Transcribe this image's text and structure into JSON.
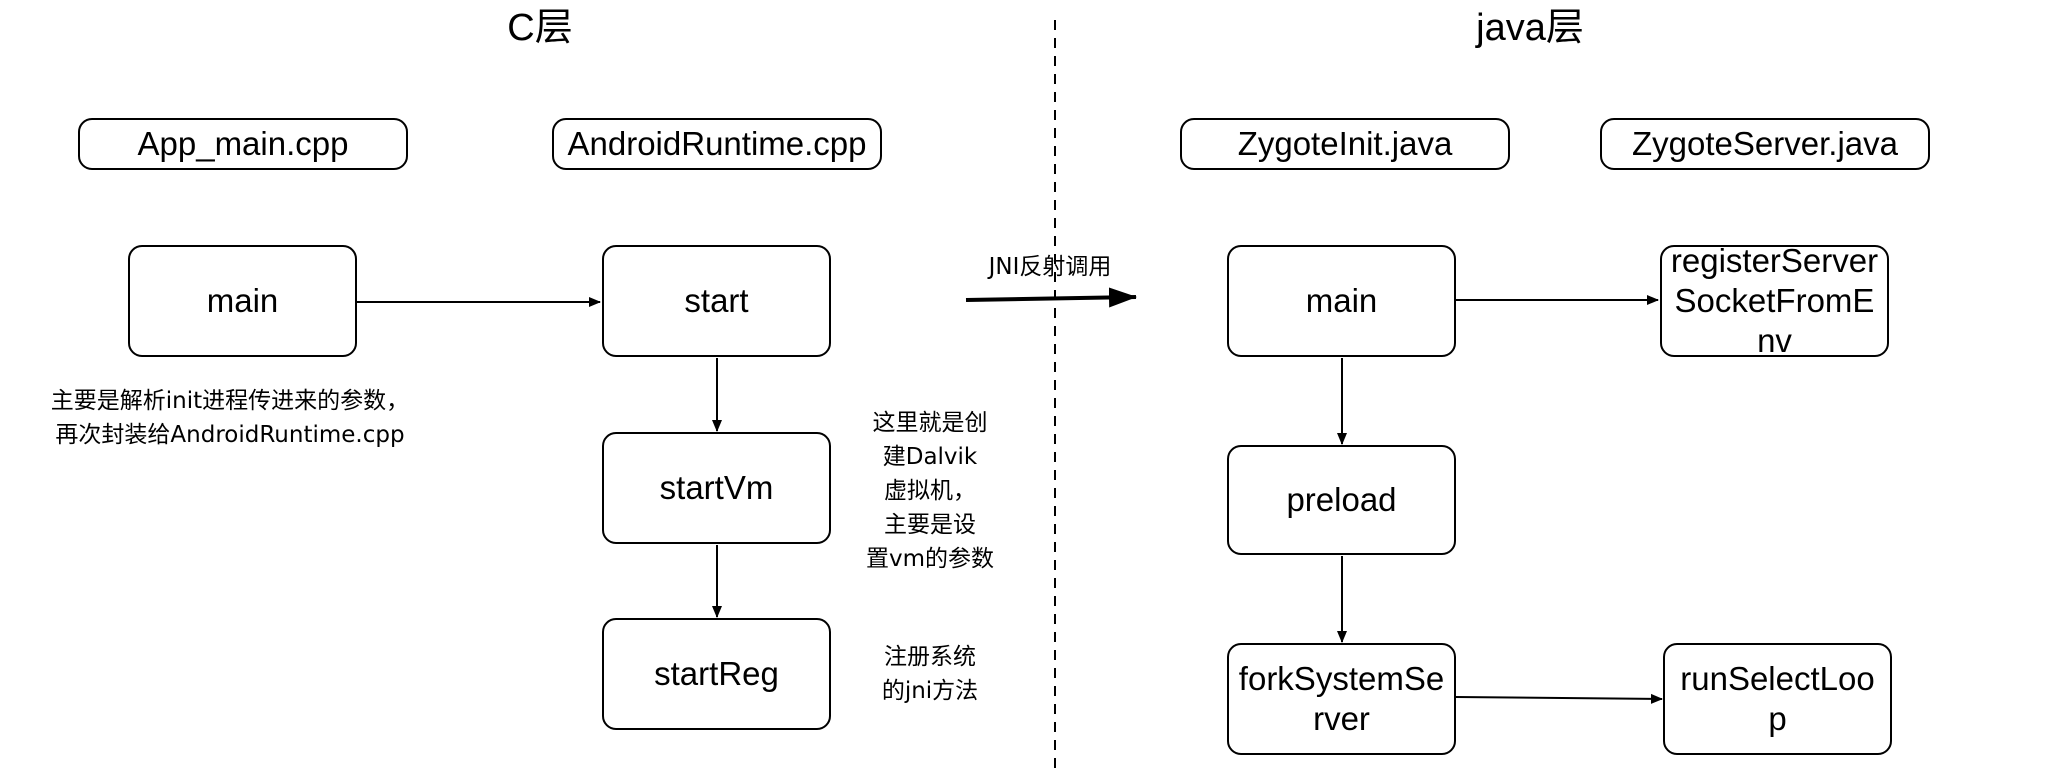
{
  "titles": {
    "c_layer": "C层",
    "java_layer": "java层"
  },
  "files": {
    "app_main": "App_main.cpp",
    "android_runtime": "AndroidRuntime.cpp",
    "zygote_init": "ZygoteInit.java",
    "zygote_server": "ZygoteServer.java"
  },
  "nodes": {
    "c_main": "main",
    "start": "start",
    "start_vm": "startVm",
    "start_reg": "startReg",
    "java_main": "main",
    "register_server": "registerServerSocketFromEnv",
    "preload": "preload",
    "fork_system_server": "forkSystemServer",
    "run_select_loop": "runSelectLoop"
  },
  "notes": {
    "main_note_line1": "主要是解析init进程传进来的参数，",
    "main_note_line2": "再次封装给AndroidRuntime.cpp",
    "startvm_note_line1": "这里就是创",
    "startvm_note_line2": "建Dalvik",
    "startvm_note_line3": "虚拟机，",
    "startvm_note_line4": "主要是设",
    "startvm_note_line5": "置vm的参数",
    "startreg_note_line1": "注册系统",
    "startreg_note_line2": "的jni方法",
    "jni_label": "JNI反射调用"
  }
}
